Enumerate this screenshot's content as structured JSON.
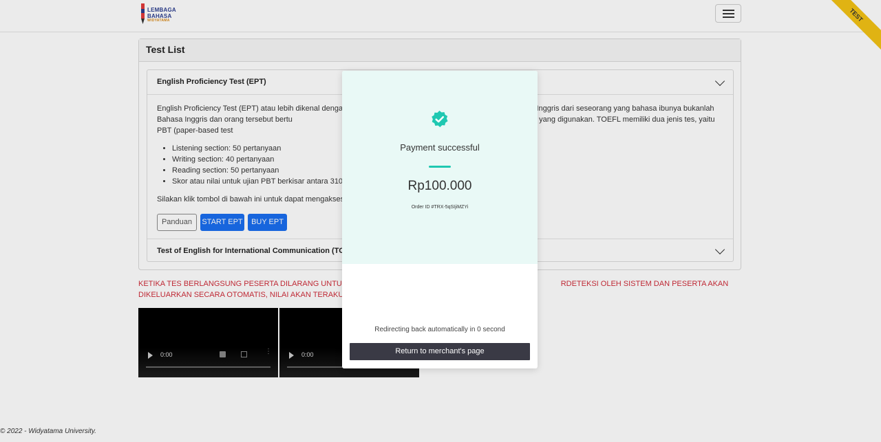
{
  "navbar": {
    "logo_line1": "LEMBAGA",
    "logo_line2": "BAHASA",
    "logo_line3": "WIDYATAMA",
    "ribbon": "TEST"
  },
  "card": {
    "title": "Test List",
    "accordion": [
      {
        "header": "English Proficiency Test (EPT)",
        "paragraph": "English Proficiency Test (EPT) atau lebih dikenal dengan T                                                     kemampuan Bahasa Inggris dari seseorang yang bahasa ibunya bukanlah Bahasa Inggris dan orang tersebut bertu                                                     n Bahasa Inggris sebagai bahasa resmi yang digunakan. TOEFL memiliki dua jenis tes, yaitu PBT (paper-based test                                                     sebagai berikut:",
        "items": [
          "Listening section: 50 pertanyaan",
          "Writing section: 40 pertanyaan",
          "Reading section: 50 pertanyaan",
          "Skor atau nilai untuk ujian PBT berkisar antara 310 –"
        ],
        "paragraph2": "Silakan klik tombol di bawah ini untuk dapat mengakses",
        "buttons": {
          "guide": "Panduan",
          "start": "START EPT",
          "buy": "BUY EPT"
        }
      },
      {
        "header": "Test of English for International Communication (TOEIC"
      }
    ]
  },
  "warning": "KETIKA TES BERLANGSUNG PESERTA DILARANG UNTUK KELUA                                                                                         RDETEKSI OLEH SISTEM DAN PESERTA AKAN DIKELUARKAN SECARA OTOMATIS, NILAI AKAN TERAKUMULASI SESUAI YANG",
  "videos": [
    {
      "time": "0:00"
    },
    {
      "time": "0:00"
    }
  ],
  "footer": "© 2022 - Widyatama University.",
  "modal": {
    "title": "Payment successful",
    "amount": "Rp100.000",
    "order_id": "Order ID #TRX-5qSIjiMZYi",
    "redirect_text": "Redirecting back automatically in 0 second",
    "return_button": "Return to merchant's page",
    "accent_color": "#1fc8b1",
    "top_bg": "#e9f9f6"
  }
}
